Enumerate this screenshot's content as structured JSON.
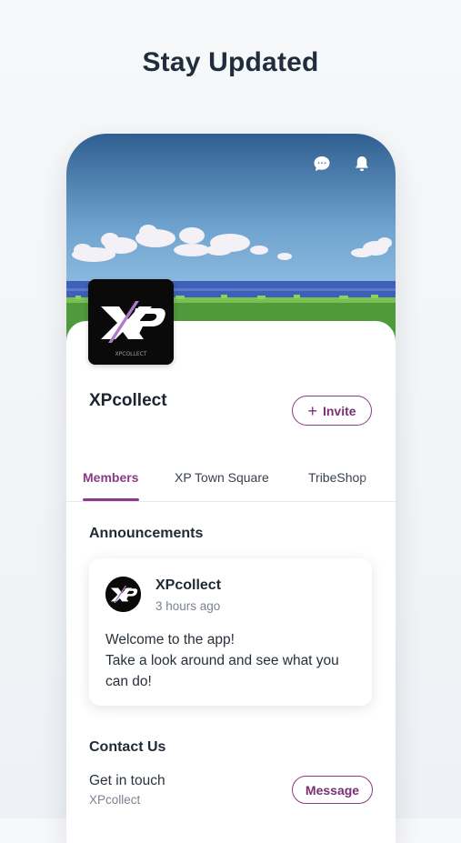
{
  "headline": "Stay Updated",
  "header_icons": {
    "chat": "chat-bubble-icon",
    "notifications": "bell-icon"
  },
  "group": {
    "name": "XPcollect",
    "logo_text": "XP",
    "invite_label": "Invite"
  },
  "tabs": [
    {
      "label": "Members",
      "active": true
    },
    {
      "label": "XP Town Square",
      "active": false
    },
    {
      "label": "TribeShop",
      "active": false
    }
  ],
  "announcements": {
    "title": "Announcements",
    "post": {
      "author": "XPcollect",
      "time": "3 hours ago",
      "body_line1": "Welcome to the app!",
      "body_line2": "Take a look around and see what you can do!"
    }
  },
  "contact": {
    "title": "Contact Us",
    "label": "Get in touch",
    "sub": "XPcollect",
    "button_label": "Message"
  },
  "colors": {
    "accent": "#8b3a86",
    "sky": "#5f95c4",
    "grass": "#4f9a3a"
  }
}
